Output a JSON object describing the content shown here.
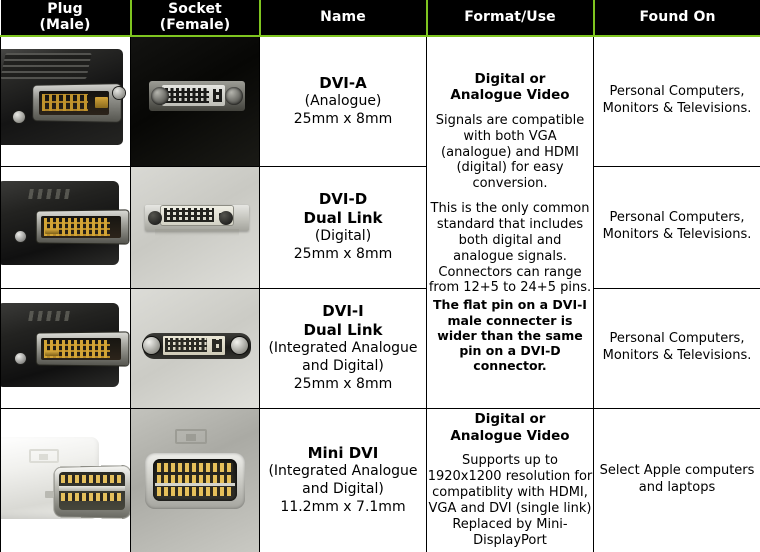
{
  "table": {
    "headers": [
      {
        "line1": "Plug",
        "line2": "(Male)"
      },
      {
        "line1": "Socket",
        "line2": "(Female)"
      },
      {
        "line1": "Name",
        "line2": ""
      },
      {
        "line1": "Format/Use",
        "line2": ""
      },
      {
        "line1": "Found On",
        "line2": ""
      }
    ],
    "rows": [
      {
        "plug_image": "dvi-a-male-connector-photo",
        "socket_image": "dvi-a-female-socket-photo",
        "name": "DVI-A",
        "dual_link": "",
        "paren": "(Analogue)",
        "paren2": "",
        "dimensions": "25mm x 8mm",
        "found_on": "Personal Computers, Monitors & Televisions."
      },
      {
        "plug_image": "dvi-d-dual-link-male-connector-photo",
        "socket_image": "dvi-d-female-socket-photo",
        "name": "DVI-D",
        "dual_link": "Dual Link",
        "paren": "(Digital)",
        "paren2": "",
        "dimensions": "25mm x 8mm",
        "found_on": "Personal Computers, Monitors & Televisions."
      },
      {
        "plug_image": "dvi-i-dual-link-male-connector-photo",
        "socket_image": "dvi-i-female-socket-photo",
        "name": "DVI-I",
        "dual_link": "Dual Link",
        "paren": "(Integrated Analogue",
        "paren2": "and Digital)",
        "dimensions": "25mm x 8mm",
        "found_on": "Personal Computers, Monitors & Televisions."
      },
      {
        "plug_image": "mini-dvi-male-connector-photo",
        "socket_image": "mini-dvi-female-socket-photo",
        "name": "Mini DVI",
        "dual_link": "",
        "paren": "(Integrated Analogue",
        "paren2": "and Digital)",
        "dimensions": "11.2mm x 7.1mm",
        "found_on": "Select Apple computers and laptops"
      }
    ],
    "format_use": {
      "dvi_group": {
        "heading_line1": "Digital or",
        "heading_line2": "Analogue Video",
        "paragraph1": "Signals are compatible with both VGA (analogue) and HDMI (digital) for easy conversion.",
        "paragraph2": "This is the only common standard that includes both digital and analogue signals. Connectors can range from 12+5 to 24+5 pins.",
        "paragraph3_bold": "The flat pin on a DVI-I male connecter is wider than the same pin on a DVI-D connector."
      },
      "mini_dvi": {
        "heading_line1": "Digital or",
        "heading_line2": "Analogue Video",
        "paragraph1": "Supports up to 1920x1200 resolution for compatiblity with HDMI, VGA and DVI (single link) Replaced by Mini-DisplayPort"
      }
    }
  },
  "colors": {
    "header_background": "#000000",
    "header_text": "#ffffff",
    "header_divider": "#7fc520",
    "cell_border": "#000000",
    "cell_background": "#ffffff",
    "body_text": "#000000"
  }
}
